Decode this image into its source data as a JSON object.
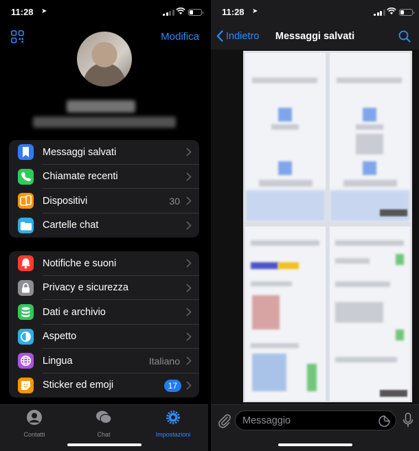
{
  "left": {
    "status": {
      "time": "11:28"
    },
    "header": {
      "edit_label": "Modifica"
    },
    "groups": [
      [
        {
          "label": "Messaggi salvati",
          "icon": "bookmark-icon",
          "color": "#2f7cf6"
        },
        {
          "label": "Chiamate recenti",
          "icon": "phone-icon",
          "color": "#34c759"
        },
        {
          "label": "Dispositivi",
          "icon": "devices-icon",
          "color": "#ff9500",
          "value": "30"
        },
        {
          "label": "Cartelle chat",
          "icon": "folder-icon",
          "color": "#32ade6"
        }
      ],
      [
        {
          "label": "Notifiche e suoni",
          "icon": "bell-icon",
          "color": "#ff3b30"
        },
        {
          "label": "Privacy e sicurezza",
          "icon": "lock-icon",
          "color": "#8e8e93"
        },
        {
          "label": "Dati e archivio",
          "icon": "database-icon",
          "color": "#34c759"
        },
        {
          "label": "Aspetto",
          "icon": "appearance-icon",
          "color": "#32ade6"
        },
        {
          "label": "Lingua",
          "icon": "globe-icon",
          "color": "#af52de",
          "value": "Italiano"
        },
        {
          "label": "Sticker ed emoji",
          "icon": "sticker-icon",
          "color": "#ff9500",
          "badge": "17"
        }
      ]
    ],
    "tabs": [
      {
        "label": "Contatti",
        "icon": "person-icon"
      },
      {
        "label": "Chat",
        "icon": "chat-bubbles-icon"
      },
      {
        "label": "Impostazioni",
        "icon": "gear-icon",
        "active": true
      }
    ]
  },
  "right": {
    "status": {
      "time": "11:28"
    },
    "header": {
      "back_label": "Indietro",
      "title": "Messaggi salvati"
    },
    "composer": {
      "placeholder": "Messaggio"
    }
  },
  "colors": {
    "accent": "#2f8bff",
    "group_bg": "#1c1c1e",
    "badge": "#1e7cf2"
  }
}
